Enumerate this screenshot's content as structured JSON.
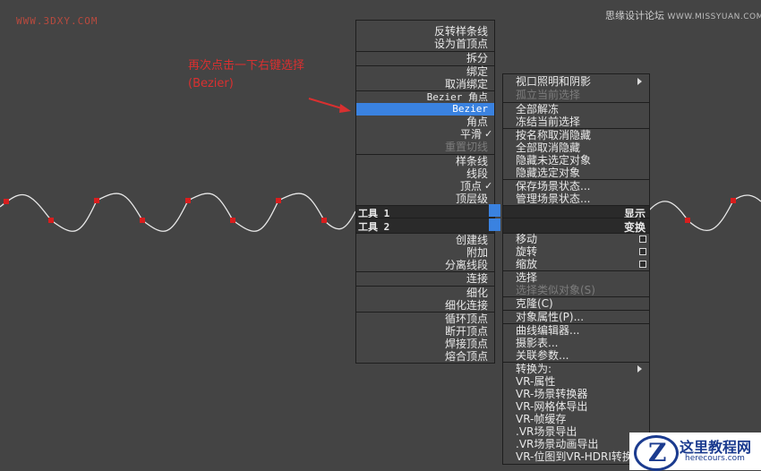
{
  "watermark_left": "WWW.3DXY.COM",
  "watermark_right": {
    "text": "思缘设计论坛",
    "small": "WWW.MISSYUAN.COM"
  },
  "annotation": "再次点击一下右键选择(Bezier)",
  "left_menu": {
    "items": [
      "反转样条线",
      "设为首顶点",
      "拆分",
      "绑定",
      "取消绑定",
      "Bezier 角点",
      "Bezier",
      "角点",
      "平滑",
      "重置切线",
      "样条线",
      "线段",
      "顶点",
      "顶层级"
    ],
    "tools1": "工具 1",
    "tools2": "工具 2",
    "items2": [
      "创建线",
      "附加",
      "分离线段",
      "连接",
      "细化",
      "细化连接",
      "循环顶点",
      "断开顶点",
      "焊接顶点",
      "熔合顶点"
    ]
  },
  "right_menu": {
    "items": [
      "视口照明和阴影",
      "孤立当前选择",
      "全部解冻",
      "冻结当前选择",
      "按名称取消隐藏",
      "全部取消隐藏",
      "隐藏未选定对象",
      "隐藏选定对象",
      "保存场景状态...",
      "管理场景状态..."
    ],
    "display": "显示",
    "transform": "变换",
    "items2": [
      "移动",
      "旋转",
      "缩放",
      "选择",
      "选择类似对象(S)",
      "克隆(C)",
      "对象属性(P)...",
      "曲线编辑器...",
      "摄影表...",
      "关联参数...",
      "转换为:",
      "VR-属性",
      "VR-场景转换器",
      "VR-网格体导出",
      "VR-帧缓存",
      ".VR场景导出",
      ".VR场景动画导出",
      "VR-位图到VR-HDRI转换器"
    ]
  },
  "check_mark": "✓",
  "logo": {
    "title": "这里教程网",
    "url": "herecours.com",
    "letter": "Z"
  },
  "colors": {
    "background": "#444444",
    "menu_bg": "#454545",
    "highlight": "#3a82e0",
    "annotation": "#d93030",
    "vertex": "#d81e1e"
  }
}
